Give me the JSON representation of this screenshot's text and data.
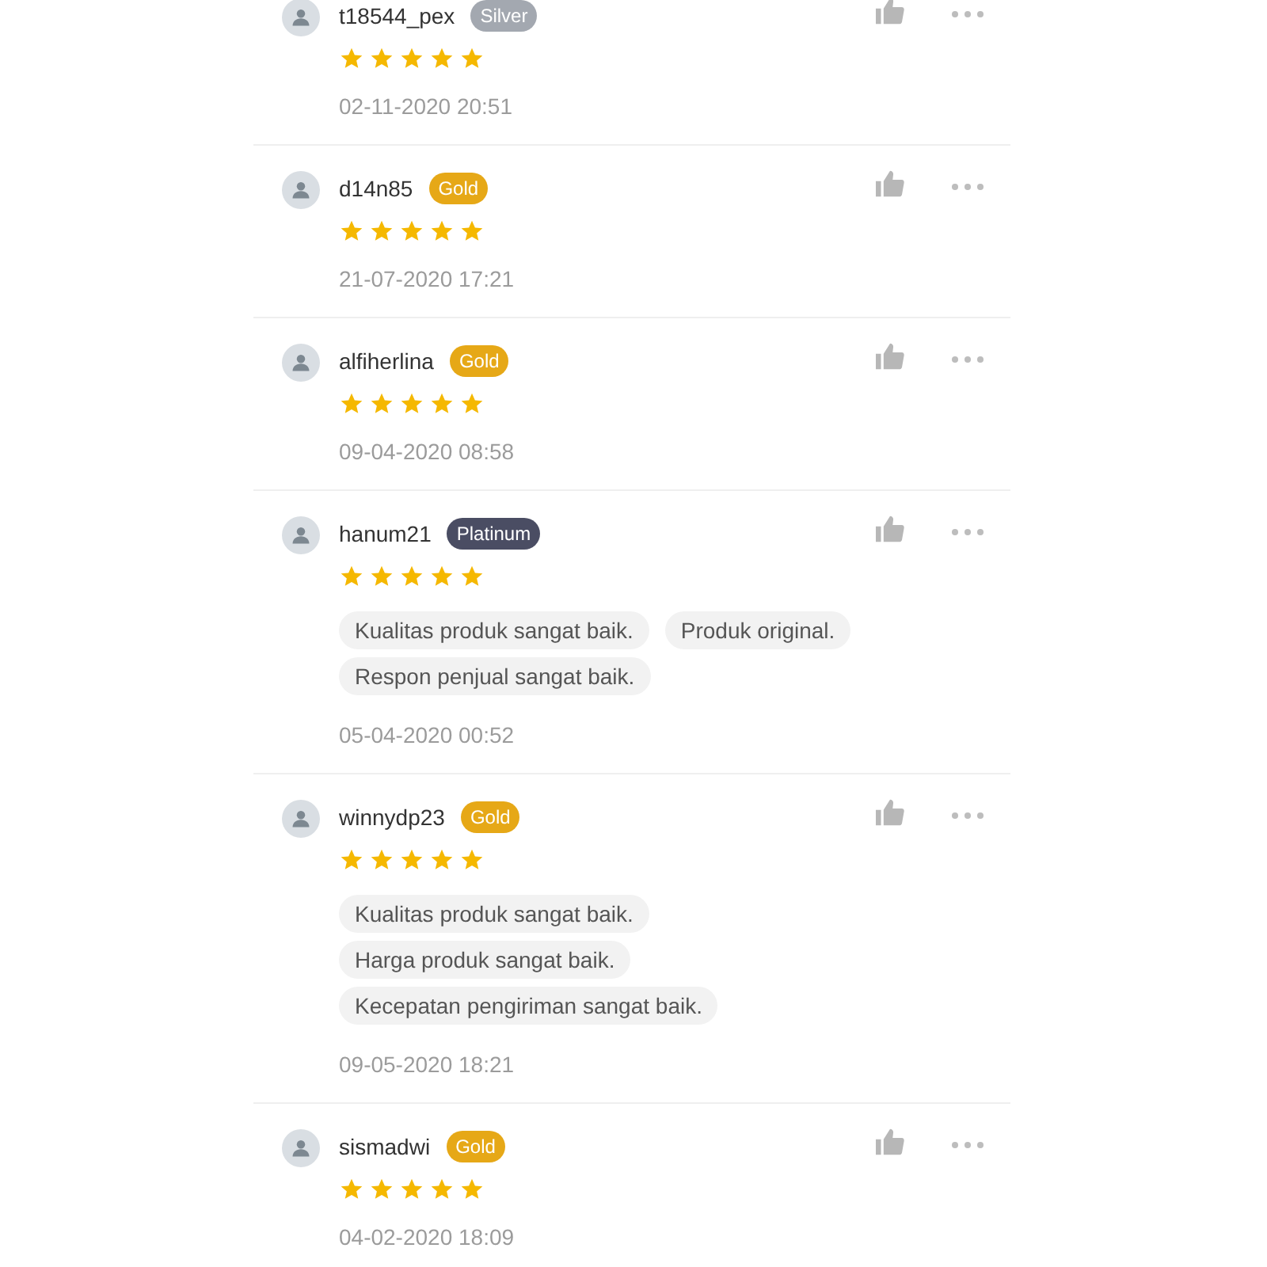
{
  "reviews": [
    {
      "username": "t18544_pex",
      "badge": {
        "label": "Silver",
        "color": "#a3a8b0"
      },
      "stars": 5,
      "date": "02-11-2020 20:51"
    },
    {
      "username": "d14n85",
      "badge": {
        "label": "Gold",
        "color": "#e6a817"
      },
      "stars": 5,
      "date": "21-07-2020 17:21"
    },
    {
      "username": "alfiherlina",
      "badge": {
        "label": "Gold",
        "color": "#e6a817"
      },
      "stars": 5,
      "date": "09-04-2020 08:58"
    },
    {
      "username": "hanum21",
      "badge": {
        "label": "Platinum",
        "color": "#4a4d63"
      },
      "stars": 5,
      "tags": [
        "Kualitas produk sangat baik.",
        "Produk original.",
        "Respon penjual sangat baik."
      ],
      "date": "05-04-2020 00:52"
    },
    {
      "username": "winnydp23",
      "badge": {
        "label": "Gold",
        "color": "#e6a817"
      },
      "stars": 5,
      "tags": [
        "Kualitas produk sangat baik.",
        "Harga produk sangat baik.",
        "Kecepatan pengiriman sangat baik."
      ],
      "date": "09-05-2020 18:21"
    },
    {
      "username": "sismadwi",
      "badge": {
        "label": "Gold",
        "color": "#e6a817"
      },
      "stars": 5,
      "date": "04-02-2020 18:09"
    }
  ]
}
